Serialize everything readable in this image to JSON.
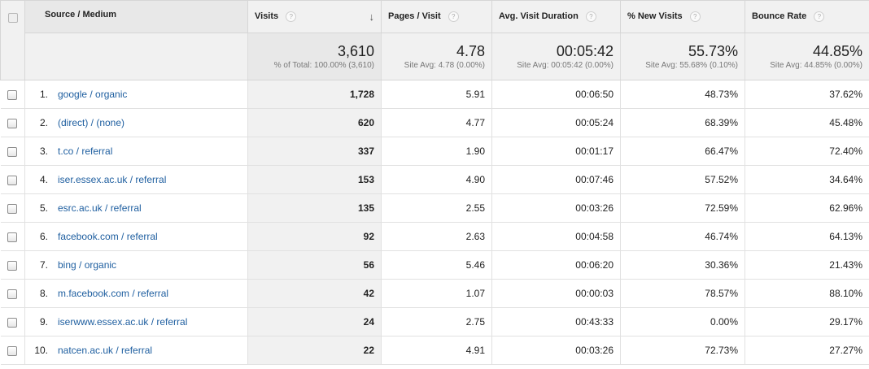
{
  "table": {
    "columns": {
      "source_medium": "Source / Medium",
      "visits": "Visits",
      "pages_per_visit": "Pages / Visit",
      "avg_visit_duration": "Avg. Visit Duration",
      "new_visits": "% New Visits",
      "bounce_rate": "Bounce Rate"
    },
    "help_glyph": "?",
    "sort_glyph": "↓",
    "totals": {
      "visits": {
        "value": "3,610",
        "sub": "% of Total: 100.00% (3,610)"
      },
      "pages_per_visit": {
        "value": "4.78",
        "sub": "Site Avg: 4.78 (0.00%)"
      },
      "avg_visit_duration": {
        "value": "00:05:42",
        "sub": "Site Avg: 00:05:42 (0.00%)"
      },
      "new_visits": {
        "value": "55.73%",
        "sub": "Site Avg: 55.68% (0.10%)"
      },
      "bounce_rate": {
        "value": "44.85%",
        "sub": "Site Avg: 44.85% (0.00%)"
      }
    },
    "rows": [
      {
        "index": "1.",
        "source": "google / organic",
        "visits": "1,728",
        "pages": "5.91",
        "duration": "00:06:50",
        "new_visits": "48.73%",
        "bounce": "37.62%"
      },
      {
        "index": "2.",
        "source": "(direct) / (none)",
        "visits": "620",
        "pages": "4.77",
        "duration": "00:05:24",
        "new_visits": "68.39%",
        "bounce": "45.48%"
      },
      {
        "index": "3.",
        "source": "t.co / referral",
        "visits": "337",
        "pages": "1.90",
        "duration": "00:01:17",
        "new_visits": "66.47%",
        "bounce": "72.40%"
      },
      {
        "index": "4.",
        "source": "iser.essex.ac.uk / referral",
        "visits": "153",
        "pages": "4.90",
        "duration": "00:07:46",
        "new_visits": "57.52%",
        "bounce": "34.64%"
      },
      {
        "index": "5.",
        "source": "esrc.ac.uk / referral",
        "visits": "135",
        "pages": "2.55",
        "duration": "00:03:26",
        "new_visits": "72.59%",
        "bounce": "62.96%"
      },
      {
        "index": "6.",
        "source": "facebook.com / referral",
        "visits": "92",
        "pages": "2.63",
        "duration": "00:04:58",
        "new_visits": "46.74%",
        "bounce": "64.13%"
      },
      {
        "index": "7.",
        "source": "bing / organic",
        "visits": "56",
        "pages": "5.46",
        "duration": "00:06:20",
        "new_visits": "30.36%",
        "bounce": "21.43%"
      },
      {
        "index": "8.",
        "source": "m.facebook.com / referral",
        "visits": "42",
        "pages": "1.07",
        "duration": "00:00:03",
        "new_visits": "78.57%",
        "bounce": "88.10%"
      },
      {
        "index": "9.",
        "source": "iserwww.essex.ac.uk / referral",
        "visits": "24",
        "pages": "2.75",
        "duration": "00:43:33",
        "new_visits": "0.00%",
        "bounce": "29.17%"
      },
      {
        "index": "10.",
        "source": "natcen.ac.uk / referral",
        "visits": "22",
        "pages": "4.91",
        "duration": "00:03:26",
        "new_visits": "72.73%",
        "bounce": "27.27%"
      }
    ]
  },
  "colors": {
    "link": "#1f5fa0",
    "header_bg": "#f1f1f1",
    "sorted_column_bg": "#e8e8e8"
  }
}
